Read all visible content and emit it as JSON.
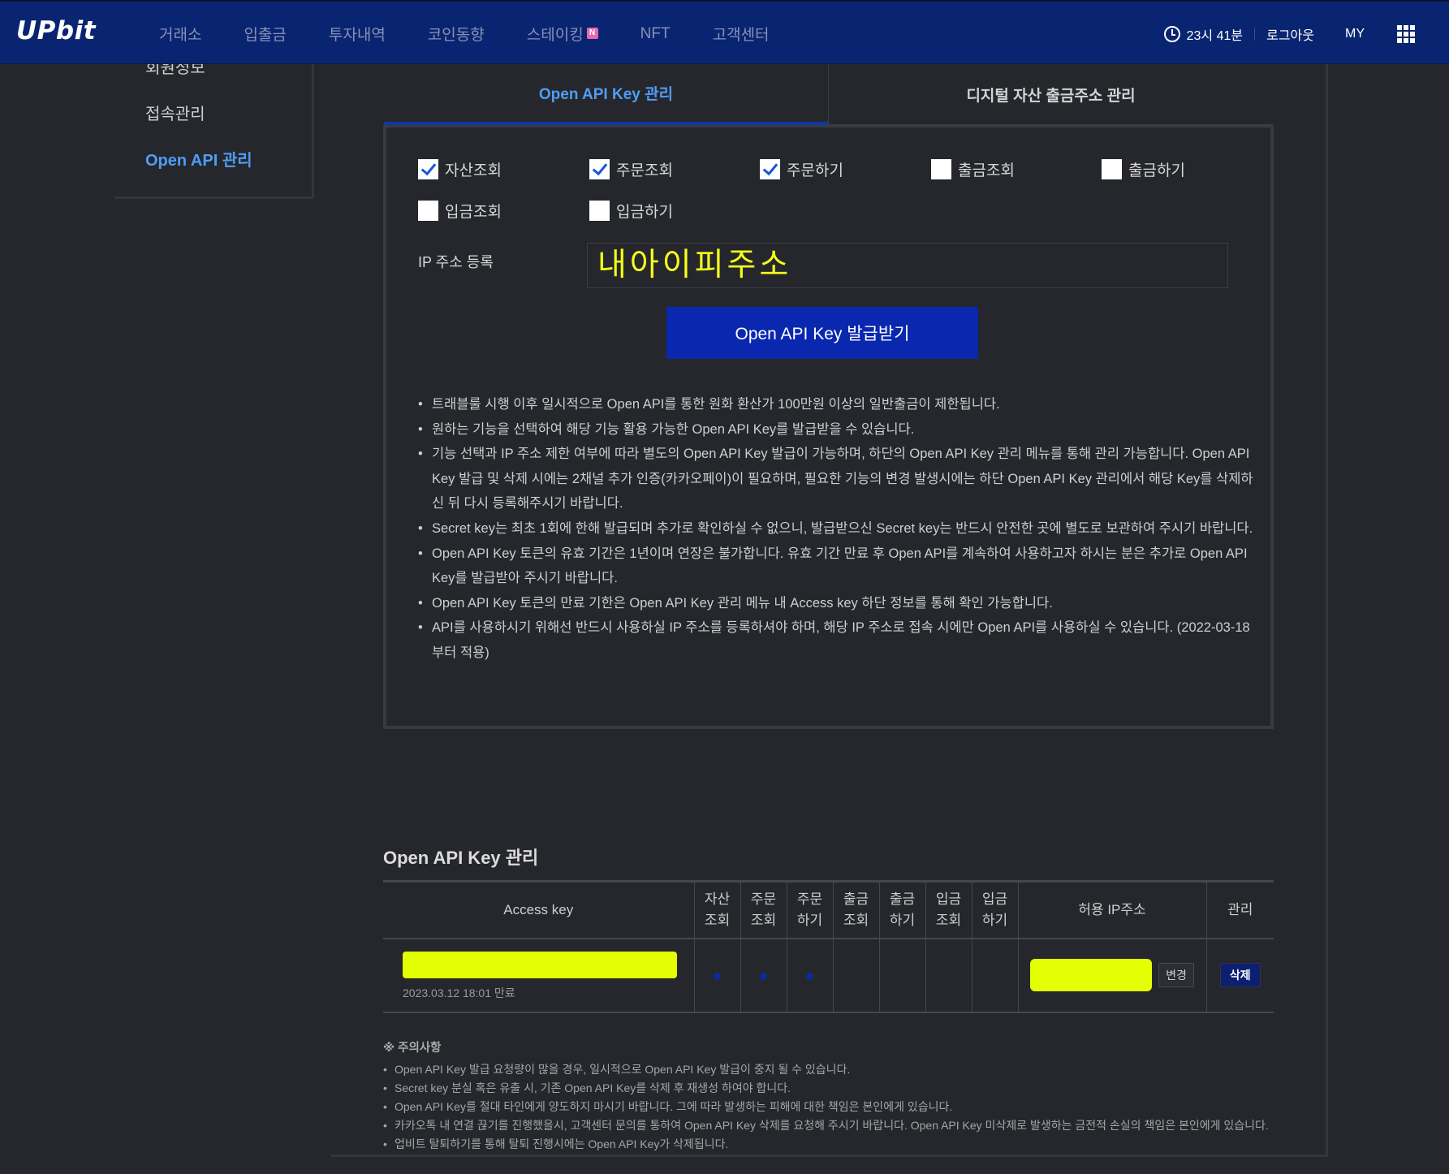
{
  "header": {
    "logo": "UPbit",
    "nav": [
      {
        "label": "거래소"
      },
      {
        "label": "입출금"
      },
      {
        "label": "투자내역"
      },
      {
        "label": "코인동향"
      },
      {
        "label": "스테이킹",
        "badge": "N"
      },
      {
        "label": "NFT"
      },
      {
        "label": "고객센터"
      }
    ],
    "clock": "23시 41분",
    "logout": "로그아웃",
    "my": "MY"
  },
  "sidebar": {
    "items": [
      {
        "label": "회원정보"
      },
      {
        "label": "접속관리"
      },
      {
        "label": "Open API 관리"
      }
    ]
  },
  "tabs": [
    {
      "label": "Open API Key 관리"
    },
    {
      "label": "디지털 자산 출금주소 관리"
    }
  ],
  "permissions": [
    {
      "label": "자산조회",
      "checked": true
    },
    {
      "label": "주문조회",
      "checked": true
    },
    {
      "label": "주문하기",
      "checked": true
    },
    {
      "label": "출금조회",
      "checked": false
    },
    {
      "label": "출금하기",
      "checked": false
    },
    {
      "label": "입금조회",
      "checked": false
    },
    {
      "label": "입금하기",
      "checked": false
    }
  ],
  "ip_register": {
    "label": "IP 주소 등록",
    "value": "내아이피주소"
  },
  "issue_button": "Open API Key 발급받기",
  "notes": [
    "트래블룰 시행 이후 일시적으로 Open API를 통한 원화 환산가 100만원 이상의 일반출금이 제한됩니다.",
    "원하는 기능을 선택하여 해당 기능 활용 가능한 Open API Key를 발급받을 수 있습니다.",
    "기능 선택과 IP 주소 제한 여부에 따라 별도의 Open API Key 발급이 가능하며, 하단의 Open API Key 관리 메뉴를 통해 관리 가능합니다. Open API Key 발급 및 삭제 시에는 2채널 추가 인증(카카오페이)이 필요하며, 필요한 기능의 변경 발생시에는 하단 Open API Key 관리에서 해당 Key를 삭제하신 뒤 다시 등록해주시기 바랍니다.",
    "Secret key는 최초 1회에 한해 발급되며 추가로 확인하실 수 없으니, 발급받으신 Secret key는 반드시 안전한 곳에 별도로 보관하여 주시기 바랍니다.",
    "Open API Key 토큰의 유효 기간은 1년이며 연장은 불가합니다. 유효 기간 만료 후 Open API를 계속하여 사용하고자 하시는 분은 추가로 Open API Key를 발급받아 주시기 바랍니다.",
    "Open API Key 토큰의 만료 기한은 Open API Key 관리 메뉴 내 Access key 하단 정보를 통해 확인 가능합니다.",
    "API를 사용하시기 위해선 반드시 사용하실 IP 주소를 등록하셔야 하며, 해당 IP 주소로 접속 시에만 Open API를 사용하실 수 있습니다. (2022-03-18 부터 적용)"
  ],
  "key_section": {
    "title": "Open API Key 관리",
    "headers": {
      "access_key": "Access key",
      "perms": [
        [
          "자산",
          "조회"
        ],
        [
          "주문",
          "조회"
        ],
        [
          "주문",
          "하기"
        ],
        [
          "출금",
          "조회"
        ],
        [
          "출금",
          "하기"
        ],
        [
          "입금",
          "조회"
        ],
        [
          "입금",
          "하기"
        ]
      ],
      "ip": "허용 IP주소",
      "manage": "관리"
    },
    "rows": [
      {
        "expire": "2023.03.12 18:01 만료",
        "perm_flags": [
          true,
          true,
          true,
          false,
          false,
          false,
          false
        ],
        "change_label": "변경",
        "delete_label": "삭제"
      }
    ]
  },
  "caution": {
    "title": "※ 주의사항",
    "items": [
      "Open API Key 발급 요청량이 많을 경우, 일시적으로 Open API Key 발급이 중지 될 수 있습니다.",
      "Secret key 분실 혹은 유출 시, 기존 Open API Key를 삭제 후 재생성 하여야 합니다.",
      "Open API Key를 절대 타인에게 양도하지 마시기 바랍니다. 그에 따라 발생하는 피해에 대한 책임은 본인에게 있습니다.",
      "카카오톡 내 연결 끊기를 진행했을시, 고객센터 문의를 통하여 Open API Key 삭제를 요청해 주시기 바랍니다. Open API Key 미삭제로 발생하는 금전적 손실의 책임은 본인에게 있습니다.",
      "업비트 탈퇴하기를 통해 탈퇴 진행시에는 Open API Key가 삭제됩니다."
    ]
  },
  "colors": {
    "header_bg": "#092470",
    "accent_blue": "#4f9df6",
    "button_blue": "#0a27b0",
    "redaction_yellow": "#e2ff04"
  }
}
